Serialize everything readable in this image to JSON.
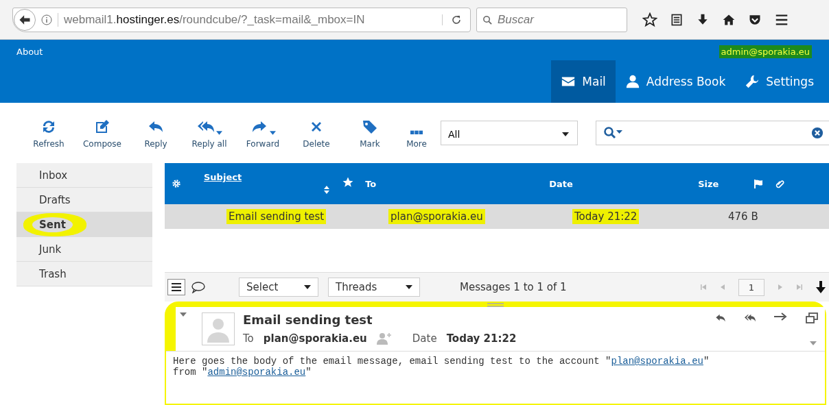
{
  "browser": {
    "url": "webmail1.**hostinger.es**/roundcube/?_task=mail&_mbox=IN",
    "search": {
      "placeholder": "Buscar"
    }
  },
  "header": {
    "about": "About",
    "user": {
      "email": "admin@sporakia.eu",
      "highlighted": true
    },
    "tabs": [
      {
        "label": "Mail",
        "selected": true
      },
      {
        "label": "Address Book",
        "selected": false
      },
      {
        "label": "Settings",
        "selected": false
      }
    ]
  },
  "toolbar": {
    "buttons": [
      {
        "label": "Refresh",
        "dropdown": false
      },
      {
        "label": "Compose",
        "dropdown": false
      },
      {
        "label": "Reply",
        "dropdown": false
      },
      {
        "label": "Reply all",
        "dropdown": true
      },
      {
        "label": "Forward",
        "dropdown": true
      },
      {
        "label": "Delete",
        "dropdown": false
      },
      {
        "label": "Mark",
        "dropdown": false
      },
      {
        "label": "More",
        "dropdown": false
      }
    ],
    "filter": {
      "value": "All"
    }
  },
  "folders": [
    {
      "label": "Inbox",
      "selected": false,
      "highlighted": false
    },
    {
      "label": "Drafts",
      "selected": false,
      "highlighted": false
    },
    {
      "label": "Sent",
      "selected": true,
      "highlighted": true
    },
    {
      "label": "Junk",
      "selected": false,
      "highlighted": false
    },
    {
      "label": "Trash",
      "selected": false,
      "highlighted": false
    }
  ],
  "message_list": {
    "columns": {
      "subject": "Subject",
      "to": "To",
      "date": "Date",
      "size": "Size"
    },
    "rows": [
      {
        "subject": "Email sending test",
        "to": "plan@sporakia.eu",
        "date": "Today 21:22",
        "size": "476 B",
        "selected": true,
        "highlighted": true
      }
    ],
    "footer": {
      "select": "Select",
      "threads": "Threads",
      "count": "Messages 1 to 1 of 1",
      "page": "1"
    }
  },
  "preview": {
    "highlighted": true,
    "subject": "Email sending test",
    "to_label": "To",
    "to": "plan@sporakia.eu",
    "date_label": "Date",
    "date": "Today 21:22",
    "body": [
      [
        {
          "kind": "text",
          "text": "Here goes the body of the email message, email sending test to the account \""
        },
        {
          "kind": "link",
          "text": "plan@sporakia.eu"
        },
        {
          "kind": "text",
          "text": "\""
        }
      ],
      [
        {
          "kind": "text",
          "text": "from \""
        },
        {
          "kind": "link",
          "text": "admin@sporakia.eu"
        },
        {
          "kind": "text",
          "text": "\""
        }
      ]
    ]
  }
}
